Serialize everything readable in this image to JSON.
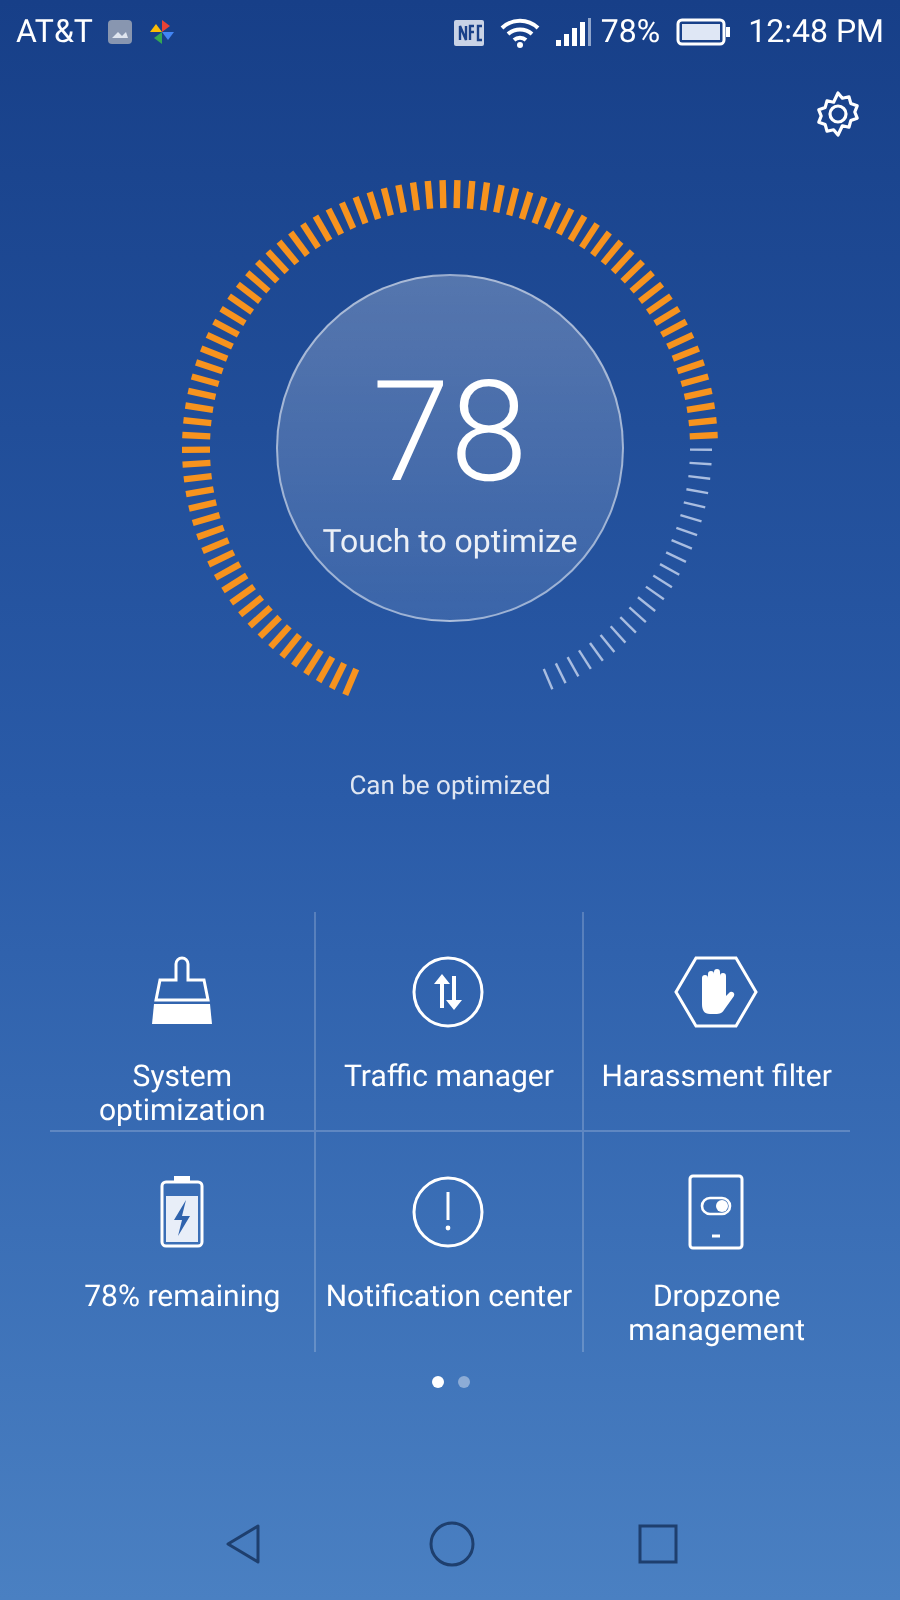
{
  "status_bar": {
    "carrier": "AT&T",
    "battery": "78%",
    "time": "12:48 PM"
  },
  "gauge": {
    "score": "78",
    "action": "Touch to optimize"
  },
  "status_text": "Can be optimized",
  "tools": [
    {
      "kind": "broom",
      "label": "System optimization"
    },
    {
      "kind": "traffic",
      "label": "Traffic manager"
    },
    {
      "kind": "hand",
      "label": "Harassment filter"
    },
    {
      "kind": "battery",
      "label": "78% remaining"
    },
    {
      "kind": "alert",
      "label": "Notification center"
    },
    {
      "kind": "dropzone",
      "label": "Dropzone management"
    }
  ],
  "pages": [
    {
      "selected": true
    },
    {
      "selected": false
    }
  ]
}
